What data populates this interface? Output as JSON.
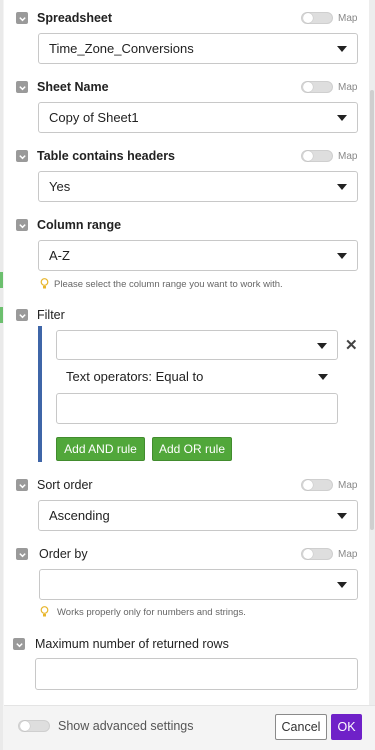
{
  "fields": {
    "spreadsheet": {
      "label": "Spreadsheet",
      "value": "Time_Zone_Conversions",
      "map_label": "Map"
    },
    "sheet_name": {
      "label": "Sheet Name",
      "value": "Copy of Sheet1",
      "map_label": "Map"
    },
    "headers": {
      "label": "Table contains headers",
      "value": "Yes",
      "map_label": "Map"
    },
    "column_range": {
      "label": "Column range",
      "value": "A-Z",
      "hint": "Please select the column range you want to work with."
    },
    "filter": {
      "label": "Filter",
      "field_value": "",
      "operator": "Text operators: Equal to",
      "value_input": "",
      "add_and_label": "Add AND rule",
      "add_or_label": "Add OR rule"
    },
    "sort_order": {
      "label": "Sort order",
      "value": "Ascending",
      "map_label": "Map"
    },
    "order_by": {
      "label": "Order by",
      "value": "",
      "map_label": "Map",
      "hint": "Works properly only for numbers and strings."
    },
    "max_rows": {
      "label": "Maximum number of returned rows",
      "value": ""
    }
  },
  "footer": {
    "advanced_label": "Show advanced settings",
    "cancel_label": "Cancel",
    "ok_label": "OK"
  },
  "colors": {
    "accent_purple": "#6f21c8",
    "rule_green": "#51a73a",
    "filter_bar_blue": "#3f66a8"
  }
}
